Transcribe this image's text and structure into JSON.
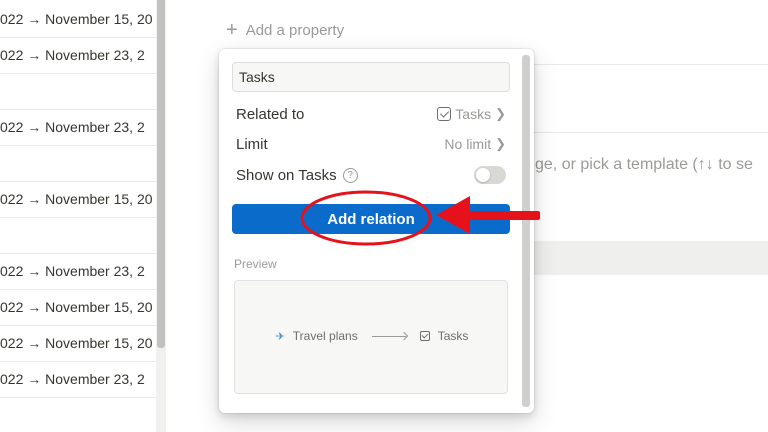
{
  "left_column": {
    "dates": [
      "022 → November 15, 20",
      "022 → November 23, 2",
      "022 → November 23, 2",
      "022 → November 15, 20",
      "022 → November 23, 2",
      "022 → November 15, 20",
      "022 → November 15, 20",
      "022 → November 23, 2"
    ]
  },
  "page": {
    "add_property_label": "Add a property",
    "hint_text": "ge, or pick a template (↑↓ to se"
  },
  "relation_popup": {
    "name_value": "Tasks",
    "related_to_label": "Related to",
    "related_to_value": "Tasks",
    "limit_label": "Limit",
    "limit_value": "No limit",
    "show_on_label": "Show on Tasks",
    "help_glyph": "?",
    "show_on_enabled": false,
    "add_button_label": "Add relation",
    "preview_label": "Preview",
    "preview_source": "Travel plans",
    "preview_target": "Tasks"
  },
  "icons": {
    "plus": "plus-icon",
    "chevron": "chevron-right-icon",
    "checkbox": "checkbox-icon",
    "help": "help-circle-icon",
    "plane": "airplane-icon"
  },
  "colors": {
    "button_blue": "#0b6bcb",
    "annotation_red": "#e5121b"
  }
}
